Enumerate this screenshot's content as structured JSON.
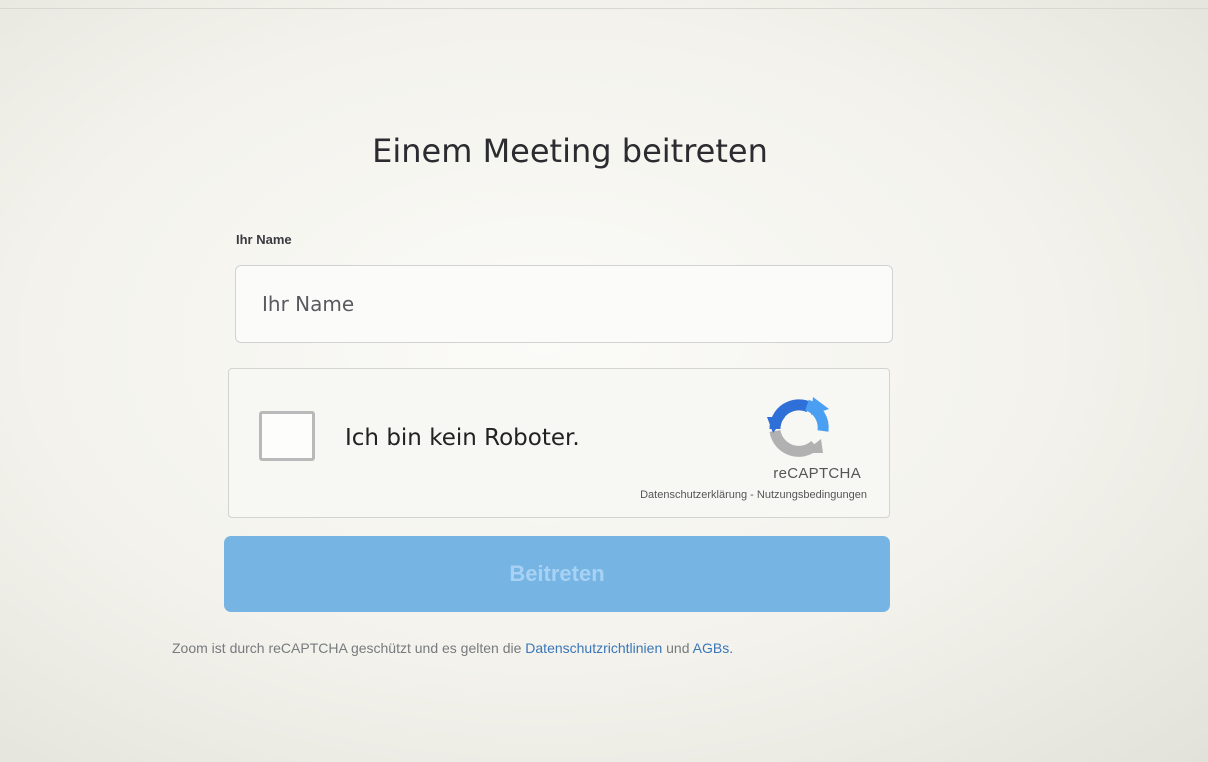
{
  "title": "Einem Meeting beitreten",
  "name_field": {
    "label": "Ihr Name",
    "placeholder": "Ihr Name",
    "value": ""
  },
  "captcha": {
    "checkbox_label": "Ich bin kein Roboter.",
    "brand": "reCAPTCHA",
    "privacy_link": "Datenschutzerklärung",
    "separator": " - ",
    "terms_link": "Nutzungsbedingungen",
    "checked": false
  },
  "join_button": {
    "label": "Beitreten",
    "enabled": false
  },
  "footer": {
    "text_before": "Zoom ist durch reCAPTCHA geschützt und es gelten die ",
    "privacy_link": "Datenschutzrichtlinien",
    "text_middle": " und ",
    "terms_link": "AGBs."
  },
  "colors": {
    "button_bg": "#76b4e4",
    "button_text": "#a8d2f3",
    "link": "#3a76b8",
    "recaptcha_blue": "#2f6fd8",
    "recaptcha_light": "#4b9ff3",
    "recaptcha_gray": "#b1b1b1"
  },
  "icons": {
    "recaptcha_logo": "recaptcha-logo-icon"
  }
}
